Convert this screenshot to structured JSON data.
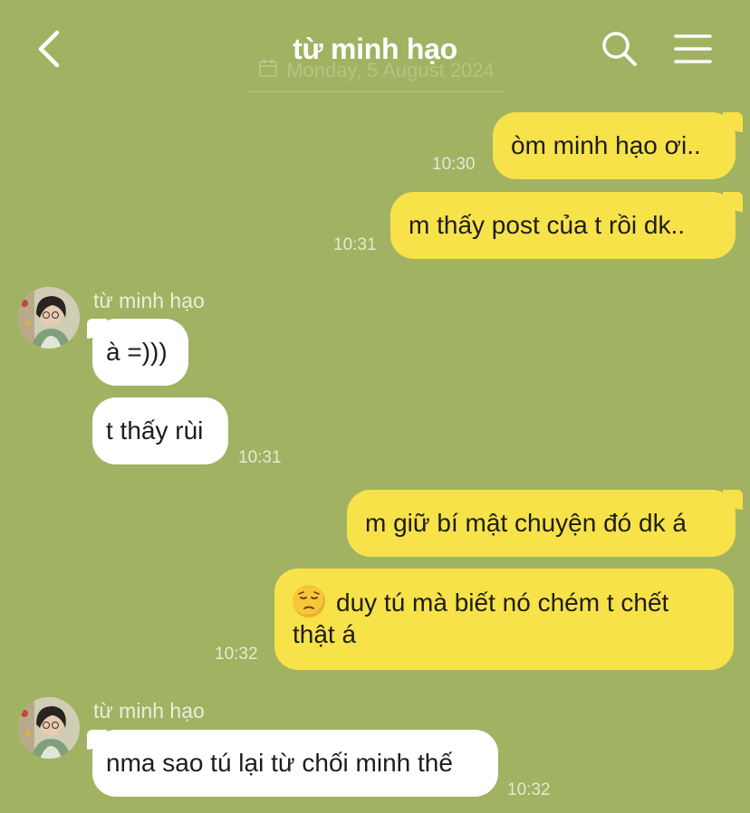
{
  "header": {
    "title": "từ minh hạo",
    "date_label": "Monday, 5 August 2024"
  },
  "messages": [
    {
      "side": "out",
      "text": "òm minh hạo ơi..",
      "time": "10:30"
    },
    {
      "side": "out",
      "text": "m thấy post của t rồi dk..",
      "time": "10:31"
    },
    {
      "side": "in",
      "sender": "từ minh hạo",
      "text": "à =)))"
    },
    {
      "side": "in",
      "text": "t thấy rùi",
      "time": "10:31"
    },
    {
      "side": "out",
      "text": "m giữ bí mật chuyện đó dk á"
    },
    {
      "side": "out",
      "emoji": "pensive-face",
      "line1": "duy tú mà biết nó chém t chết",
      "line2": "thật á",
      "time": "10:32"
    },
    {
      "side": "in",
      "sender": "từ minh hạo",
      "text": "nma sao tú lại từ chối minh thế",
      "time": "10:32"
    }
  ],
  "colors": {
    "background": "#a1b262",
    "outgoing_bubble": "#f7e249",
    "incoming_bubble": "#ffffff"
  }
}
